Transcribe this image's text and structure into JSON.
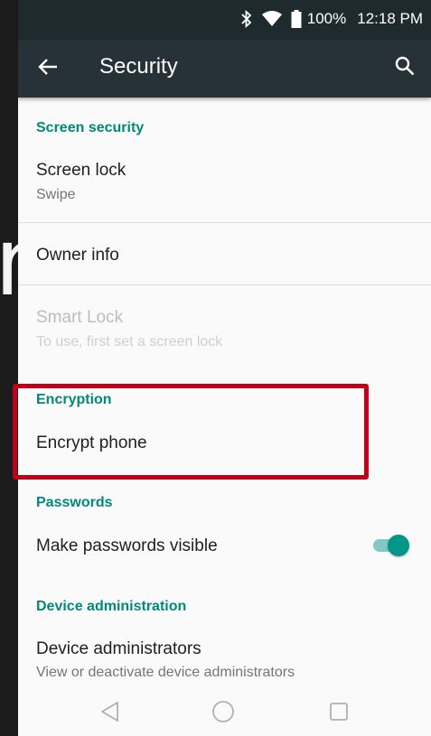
{
  "background_glyph": "n",
  "status_bar": {
    "battery": "100%",
    "time": "12:18 PM",
    "icons": [
      "bluetooth-icon",
      "wifi-icon",
      "battery-icon"
    ]
  },
  "app_bar": {
    "title": "Security",
    "back_icon": "arrow-back-icon",
    "search_icon": "search-icon"
  },
  "sections": {
    "screen_security": {
      "header": "Screen security",
      "screen_lock": {
        "title": "Screen lock",
        "subtitle": "Swipe"
      },
      "owner_info": {
        "title": "Owner info"
      },
      "smart_lock": {
        "title": "Smart Lock",
        "subtitle": "To use, first set a screen lock",
        "enabled": false
      }
    },
    "encryption": {
      "header": "Encryption",
      "encrypt_phone": {
        "title": "Encrypt phone"
      }
    },
    "passwords": {
      "header": "Passwords",
      "make_visible": {
        "title": "Make passwords visible",
        "checked": true
      }
    },
    "device_administration": {
      "header": "Device administration",
      "device_admins": {
        "title": "Device administrators",
        "subtitle": "View or deactivate device administrators"
      }
    }
  },
  "nav_bar": {
    "icons": [
      "back-triangle-icon",
      "home-circle-icon",
      "recents-square-icon"
    ]
  },
  "colors": {
    "accent": "#00897b",
    "toolbar": "#263238",
    "status_bar": "#1f2a2e",
    "highlight": "#c00018"
  }
}
